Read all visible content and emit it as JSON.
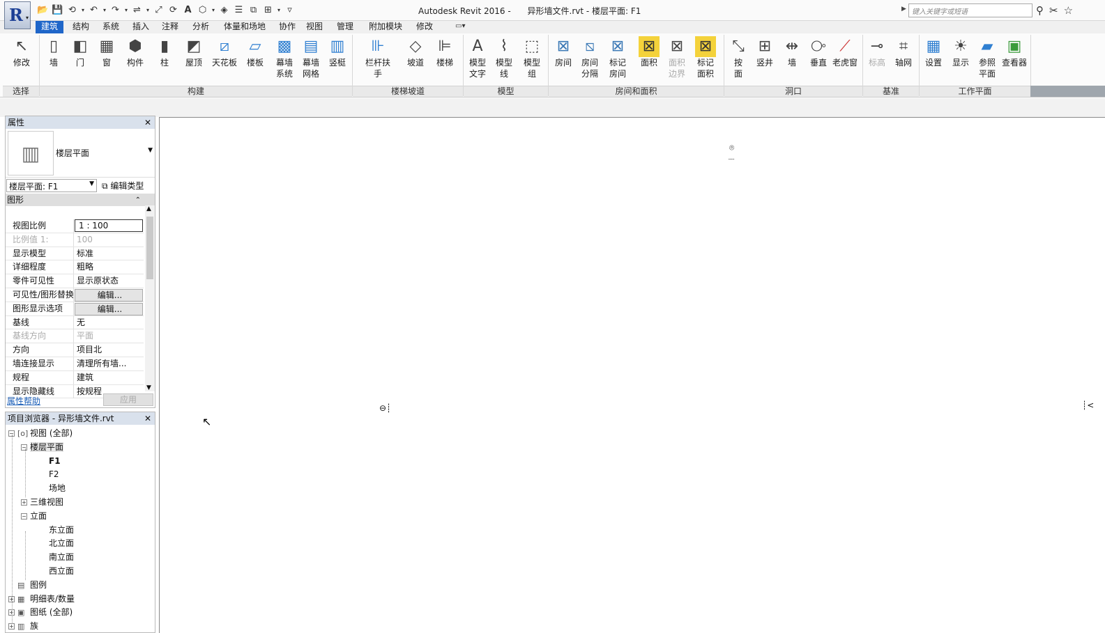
{
  "app": {
    "title": "Autodesk Revit 2016 -",
    "doc": "异形墙文件.rvt - 楼层平面: F1",
    "search_placeholder": "键入关键字或短语"
  },
  "tabs": [
    "建筑",
    "结构",
    "系统",
    "插入",
    "注释",
    "分析",
    "体量和场地",
    "协作",
    "视图",
    "管理",
    "附加模块",
    "修改"
  ],
  "active_tab": "建筑",
  "ribbon": {
    "tools": [
      {
        "label": "修改",
        "icon": "cursor-icon"
      },
      {
        "label": "墙",
        "icon": "wall-icon"
      },
      {
        "label": "门",
        "icon": "door-icon"
      },
      {
        "label": "窗",
        "icon": "window-icon"
      },
      {
        "label": "构件",
        "icon": "component-icon"
      },
      {
        "label": "柱",
        "icon": "column-icon"
      },
      {
        "label": "屋顶",
        "icon": "roof-icon"
      },
      {
        "label": "天花板",
        "icon": "ceiling-icon"
      },
      {
        "label": "楼板",
        "icon": "floor-icon"
      },
      {
        "label": "幕墙\n系统",
        "icon": "curtain-system-icon"
      },
      {
        "label": "幕墙\n网格",
        "icon": "curtain-grid-icon"
      },
      {
        "label": "竖梃",
        "icon": "mullion-icon"
      },
      {
        "label": "栏杆扶手",
        "icon": "railing-icon"
      },
      {
        "label": "坡道",
        "icon": "ramp-icon"
      },
      {
        "label": "楼梯",
        "icon": "stair-icon"
      },
      {
        "label": "模型\n文字",
        "icon": "model-text-icon"
      },
      {
        "label": "模型\n线",
        "icon": "model-line-icon"
      },
      {
        "label": "模型\n组",
        "icon": "model-group-icon"
      },
      {
        "label": "房间",
        "icon": "room-icon"
      },
      {
        "label": "房间\n分隔",
        "icon": "room-separator-icon"
      },
      {
        "label": "标记\n房间",
        "icon": "tag-room-icon"
      },
      {
        "label": "面积",
        "icon": "area-icon"
      },
      {
        "label": "面积\n边界",
        "icon": "area-boundary-icon"
      },
      {
        "label": "标记\n面积",
        "icon": "tag-area-icon"
      },
      {
        "label": "按\n面",
        "icon": "by-face-icon"
      },
      {
        "label": "竖井",
        "icon": "shaft-icon"
      },
      {
        "label": "墙",
        "icon": "wall-opening-icon"
      },
      {
        "label": "垂直",
        "icon": "vertical-icon"
      },
      {
        "label": "老虎窗",
        "icon": "dormer-icon"
      },
      {
        "label": "标高",
        "icon": "level-icon"
      },
      {
        "label": "轴网",
        "icon": "grid-icon"
      },
      {
        "label": "设置",
        "icon": "set-icon"
      },
      {
        "label": "显示",
        "icon": "show-icon"
      },
      {
        "label": "参照\n平面",
        "icon": "ref-plane-icon"
      },
      {
        "label": "查看器",
        "icon": "viewer-icon"
      }
    ],
    "panels": [
      "选择",
      "构建",
      "楼梯坡道",
      "模型",
      "房间和面积",
      "洞口",
      "基准",
      "工作平面"
    ]
  },
  "properties": {
    "header": "属性",
    "type_name": "楼层平面",
    "selector": "楼层平面: F1",
    "edit_type": "编辑类型",
    "group": "图形",
    "rows": [
      {
        "k": "视图比例",
        "v": "1 : 100"
      },
      {
        "k": "比例值 1:",
        "v": "100"
      },
      {
        "k": "显示模型",
        "v": "标准"
      },
      {
        "k": "详细程度",
        "v": "粗略"
      },
      {
        "k": "零件可见性",
        "v": "显示原状态"
      },
      {
        "k": "可见性/图形替换",
        "v": "编辑..."
      },
      {
        "k": "图形显示选项",
        "v": "编辑..."
      },
      {
        "k": "基线",
        "v": "无"
      },
      {
        "k": "基线方向",
        "v": "平面"
      },
      {
        "k": "方向",
        "v": "项目北"
      },
      {
        "k": "墙连接显示",
        "v": "清理所有墙..."
      },
      {
        "k": "规程",
        "v": "建筑"
      },
      {
        "k": "显示隐藏线",
        "v": "按规程"
      }
    ],
    "help": "属性帮助",
    "apply": "应用"
  },
  "browser": {
    "header": "项目浏览器 - 异形墙文件.rvt",
    "items": [
      {
        "label": "视图 (全部)"
      },
      {
        "label": "楼层平面"
      },
      {
        "label": "F1"
      },
      {
        "label": "F2"
      },
      {
        "label": "场地"
      },
      {
        "label": "三维视图"
      },
      {
        "label": "立面"
      },
      {
        "label": "东立面"
      },
      {
        "label": "北立面"
      },
      {
        "label": "南立面"
      },
      {
        "label": "西立面"
      },
      {
        "label": "图例"
      },
      {
        "label": "明细表/数量"
      },
      {
        "label": "图纸 (全部)"
      },
      {
        "label": "族"
      }
    ]
  }
}
